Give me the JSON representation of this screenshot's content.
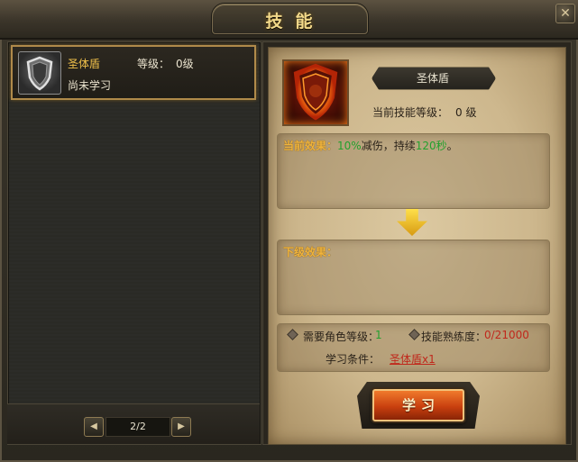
{
  "window": {
    "title": "技能",
    "close_glyph": "✕"
  },
  "skill_list": {
    "items": [
      {
        "name": "圣体盾",
        "level_label": "等级：",
        "level_value": "0级",
        "status": "尚未学习",
        "icon": "shield-icon"
      }
    ],
    "pager": {
      "prev_glyph": "◀",
      "next_glyph": "▶",
      "page_text": "2/2"
    }
  },
  "detail": {
    "skill_name": "圣体盾",
    "icon": "flaming-shield-icon",
    "current_level_label": "当前技能等级：",
    "current_level_value": "0 级",
    "current_effect": {
      "label": "当前效果：",
      "value1": "10%",
      "text1": "减伤，持续",
      "value2": "120秒",
      "text2": "。"
    },
    "next_effect": {
      "label": "下级效果："
    },
    "requirements": {
      "role_level_label": "需要角色等级：",
      "role_level_value": "1",
      "proficiency_label": "技能熟练度：",
      "proficiency_value": "0/21000",
      "condition_label": "学习条件：",
      "condition_value": "圣体盾x1"
    },
    "learn_button_label": "学习"
  },
  "colors": {
    "accent_gold": "#f0c04a",
    "value_green": "#23a12e",
    "value_red": "#c0281c",
    "button_orange": "#c9400f"
  }
}
